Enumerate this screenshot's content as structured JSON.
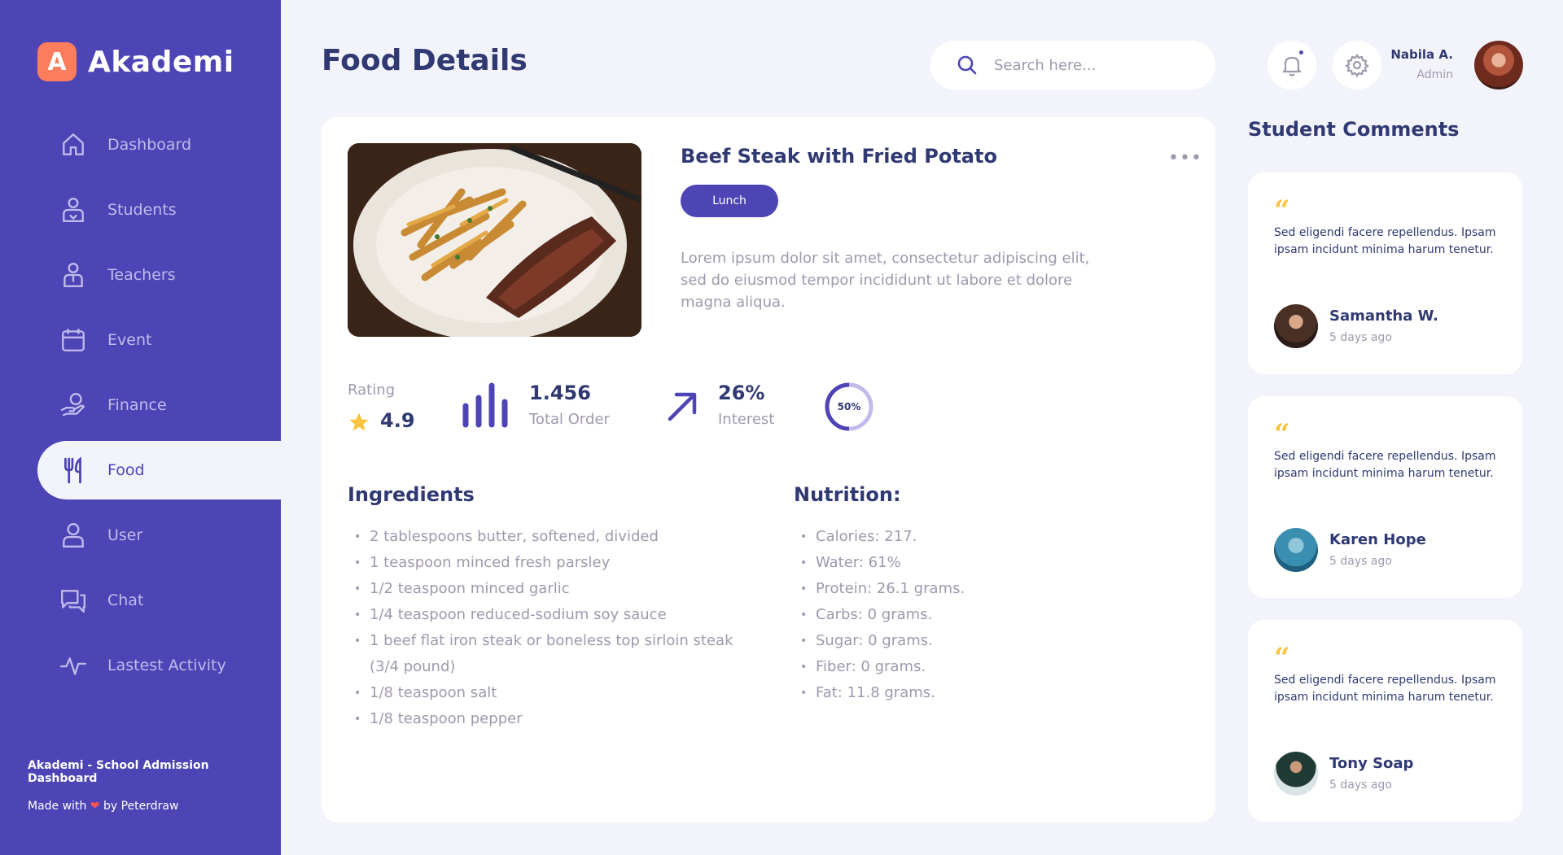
{
  "brand": {
    "letter": "A",
    "name": "Akademi"
  },
  "nav": [
    {
      "label": "Dashboard",
      "icon": "home-icon"
    },
    {
      "label": "Students",
      "icon": "student-icon"
    },
    {
      "label": "Teachers",
      "icon": "teacher-icon"
    },
    {
      "label": "Event",
      "icon": "calendar-icon"
    },
    {
      "label": "Finance",
      "icon": "finance-icon"
    },
    {
      "label": "Food",
      "icon": "food-icon",
      "active": true
    },
    {
      "label": "User",
      "icon": "user-icon"
    },
    {
      "label": "Chat",
      "icon": "chat-icon"
    },
    {
      "label": "Lastest Activity",
      "icon": "activity-icon"
    }
  ],
  "footer": {
    "title": "Akademi - School Admission Dashboard",
    "made_prefix": "Made with",
    "heart": "❤",
    "made_suffix": "by Peterdraw"
  },
  "header": {
    "title": "Food Details",
    "search_placeholder": "Search here...",
    "user_name": "Nabila A.",
    "user_role": "Admin"
  },
  "food": {
    "name": "Beef Steak with Fried Potato",
    "tag": "Lunch",
    "description": "Lorem ipsum dolor sit amet, consectetur adipiscing elit, sed do eiusmod tempor incididunt ut labore et dolore magna aliqua.",
    "menu_glyph": "•••",
    "stats": {
      "rating_label": "Rating",
      "rating_value": "4.9",
      "orders_value": "1.456",
      "orders_label": "Total Order",
      "interest_value": "26%",
      "interest_label": "Interest",
      "progress_text": "50%",
      "progress_fraction": 0.5
    },
    "ingredients_title": "Ingredients",
    "ingredients": [
      "2 tablespoons butter, softened, divided",
      "1 teaspoon minced fresh parsley",
      "1/2 teaspoon minced garlic",
      "1/4 teaspoon reduced-sodium soy sauce",
      "1 beef flat iron steak or boneless top sirloin steak (3/4 pound)",
      "1/8 teaspoon salt",
      "1/8 teaspoon pepper"
    ],
    "nutrition_title": "Nutrition:",
    "nutrition": [
      "Calories: 217.",
      "Water: 61%",
      "Protein: 26.1 grams.",
      "Carbs: 0 grams.",
      "Sugar: 0 grams.",
      "Fiber: 0 grams.",
      "Fat: 11.8 grams."
    ]
  },
  "comments": {
    "title": "Student Comments",
    "items": [
      {
        "text": "Sed eligendi facere repellendus. Ipsam ipsam incidunt minima harum tenetur.",
        "name": "Samantha W.",
        "time": "5 days ago"
      },
      {
        "text": "Sed eligendi facere repellendus. Ipsam ipsam incidunt minima harum tenetur.",
        "name": "Karen Hope",
        "time": "5 days ago"
      },
      {
        "text": "Sed eligendi facere repellendus. Ipsam ipsam incidunt minima harum tenetur.",
        "name": "Tony Soap",
        "time": "5 days ago"
      }
    ]
  },
  "colors": {
    "primary": "#4d44b5",
    "dark": "#303972",
    "muted": "#a098ae",
    "accent_orange": "#fb7d5b",
    "accent_yellow": "#fcc43e",
    "background": "#f3f4fb"
  }
}
